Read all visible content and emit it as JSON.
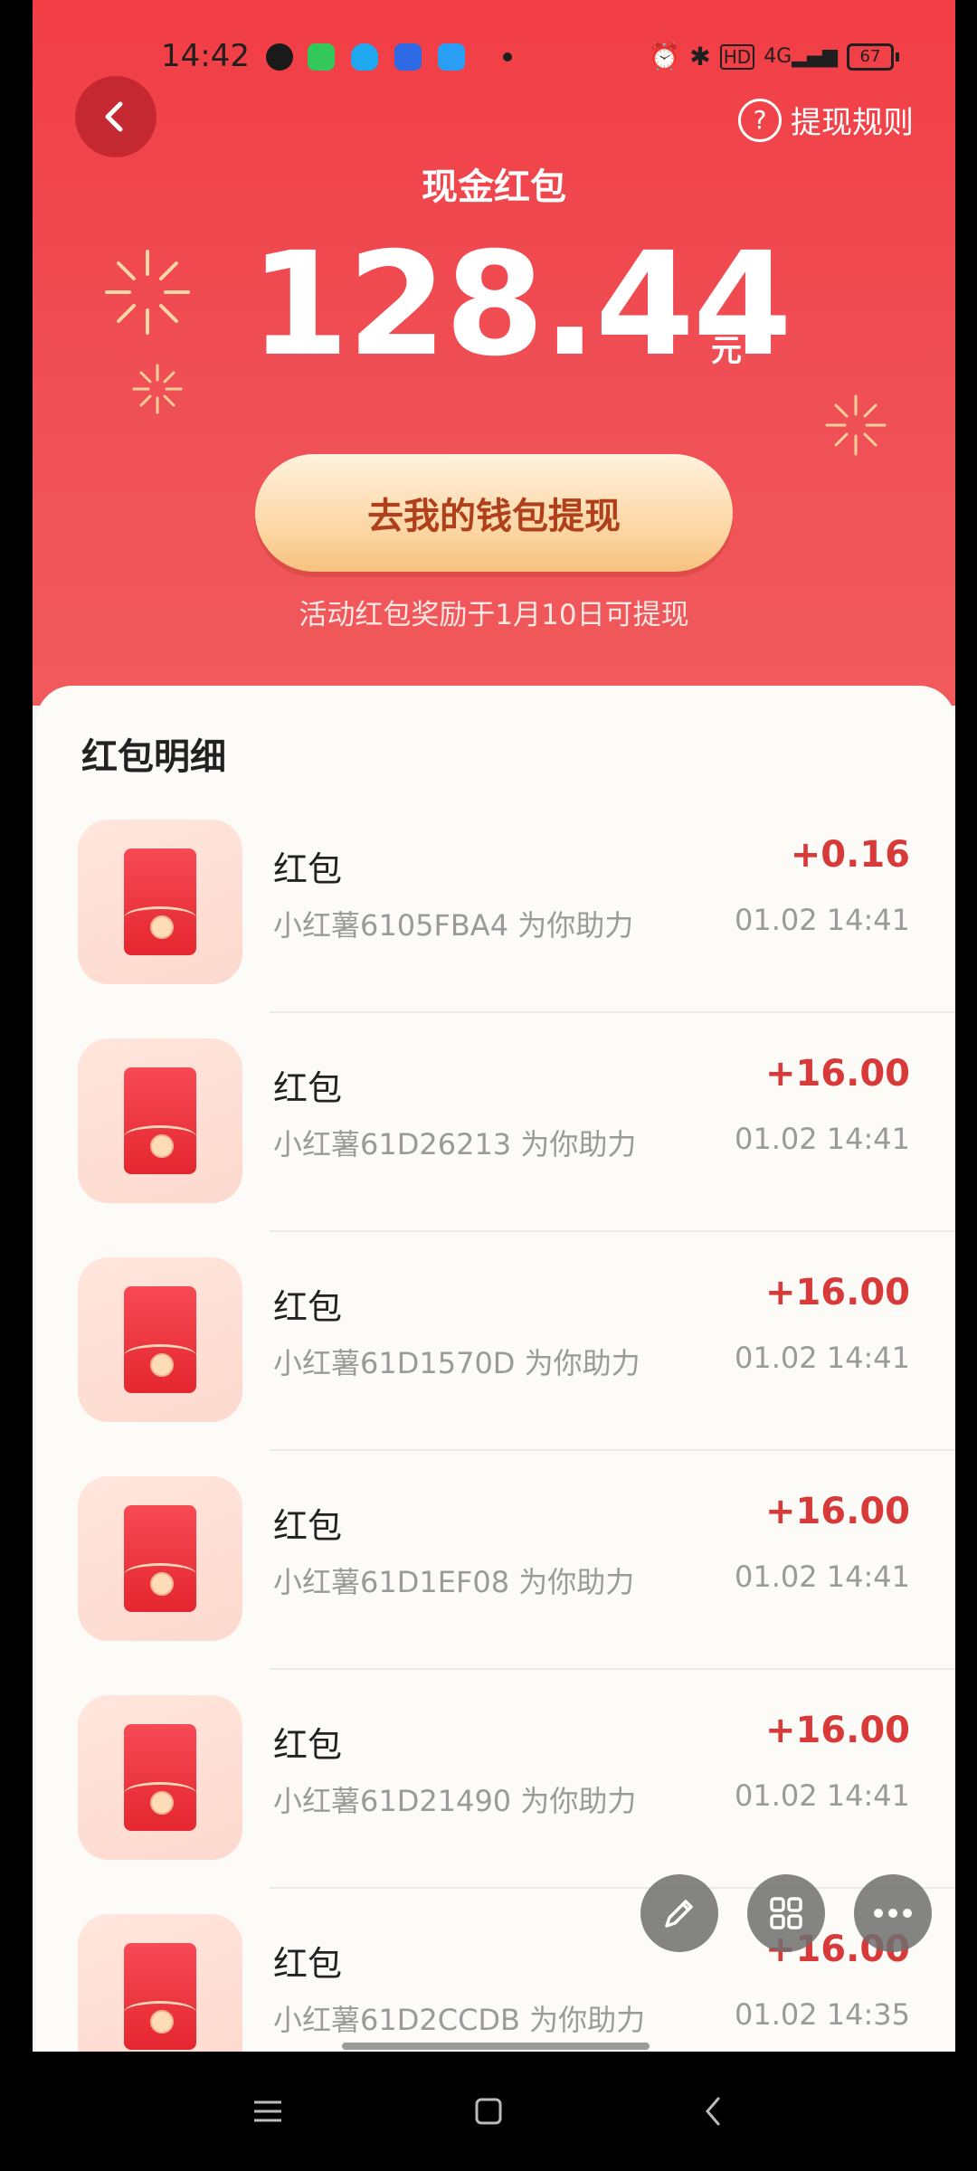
{
  "status_bar": {
    "time": "14:42",
    "battery": "67"
  },
  "header": {
    "rules_label": "提现规则",
    "title": "现金红包",
    "amount": "128.44",
    "unit": "元",
    "withdraw_button": "去我的钱包提现",
    "notice": "活动红包奖励于1月10日可提现"
  },
  "list": {
    "title": "红包明细",
    "items": [
      {
        "name": "红包",
        "desc": "小红薯6105FBA4 为你助力",
        "amount": "+0.16",
        "time": "01.02 14:41"
      },
      {
        "name": "红包",
        "desc": "小红薯61D26213 为你助力",
        "amount": "+16.00",
        "time": "01.02 14:41"
      },
      {
        "name": "红包",
        "desc": "小红薯61D1570D 为你助力",
        "amount": "+16.00",
        "time": "01.02 14:41"
      },
      {
        "name": "红包",
        "desc": "小红薯61D1EF08 为你助力",
        "amount": "+16.00",
        "time": "01.02 14:41"
      },
      {
        "name": "红包",
        "desc": "小红薯61D21490 为你助力",
        "amount": "+16.00",
        "time": "01.02 14:41"
      },
      {
        "name": "红包",
        "desc": "小红薯61D2CCDB 为你助力",
        "amount": "+16.00",
        "time": "01.02 14:35"
      }
    ]
  },
  "colors": {
    "hero_red": "#f23d45",
    "amount_red": "#d83a3a",
    "button_gold": "#fcd6a3"
  },
  "icons": [
    "back-arrow-icon",
    "question-icon",
    "pen-icon",
    "grid-icon",
    "more-icon",
    "menu-icon",
    "home-square-icon",
    "back-icon"
  ]
}
